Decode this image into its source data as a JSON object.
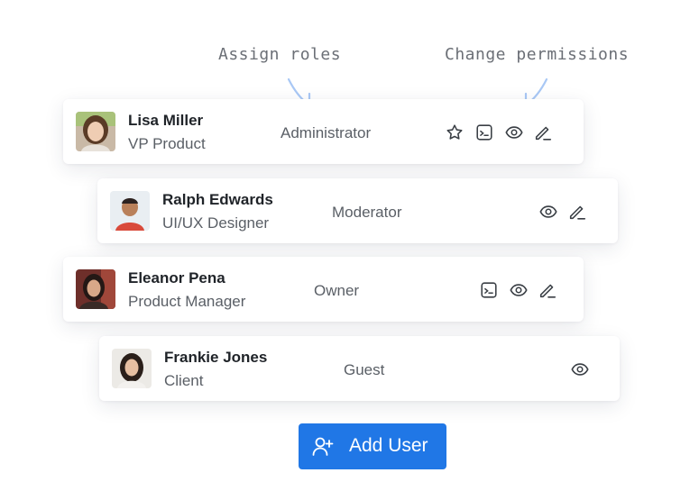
{
  "annotations": {
    "assign_roles": "Assign roles",
    "change_permissions": "Change permissions"
  },
  "users": [
    {
      "name": "Lisa Miller",
      "title": "VP Product",
      "role": "Administrator",
      "actions": [
        "star-icon",
        "terminal-icon",
        "eye-icon",
        "edit-icon"
      ]
    },
    {
      "name": "Ralph Edwards",
      "title": "UI/UX Designer",
      "role": "Moderator",
      "actions": [
        "eye-icon",
        "edit-icon"
      ]
    },
    {
      "name": "Eleanor Pena",
      "title": "Product Manager",
      "role": "Owner",
      "actions": [
        "terminal-icon",
        "eye-icon",
        "edit-icon"
      ]
    },
    {
      "name": "Frankie Jones",
      "title": "Client",
      "role": "Guest",
      "actions": [
        "eye-icon"
      ]
    }
  ],
  "add_user": {
    "label": "Add User",
    "icon": "add-user-icon"
  },
  "colors": {
    "accent": "#2077e6",
    "arrow": "#a9c8f5",
    "icon": "#3a3f45"
  }
}
